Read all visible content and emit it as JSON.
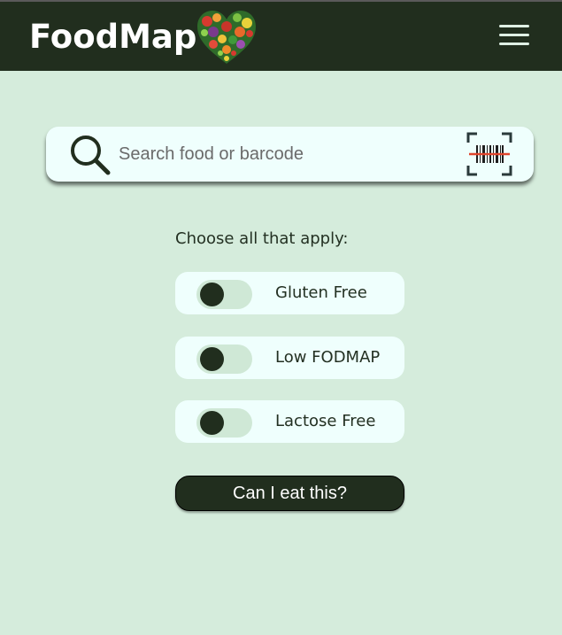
{
  "header": {
    "title": "FoodMap",
    "logo_icon": "heart-of-vegetables-icon",
    "menu_icon": "hamburger-menu-icon",
    "background": "#212e1e"
  },
  "search": {
    "placeholder": "Search food or barcode",
    "value": "",
    "search_icon": "magnifier-icon",
    "scan_icon": "barcode-scan-icon"
  },
  "filters": {
    "prompt": "Choose all that apply:",
    "options": [
      {
        "label": "Gluten Free",
        "checked": false
      },
      {
        "label": "Low FODMAP",
        "checked": false
      },
      {
        "label": "Lactose Free",
        "checked": false
      }
    ]
  },
  "submit": {
    "label": "Can I eat this?"
  },
  "colors": {
    "page_background": "#d5ecdc",
    "card_background": "#effffd",
    "accent_dark": "#212e1e",
    "scan_line": "#e0442c"
  }
}
